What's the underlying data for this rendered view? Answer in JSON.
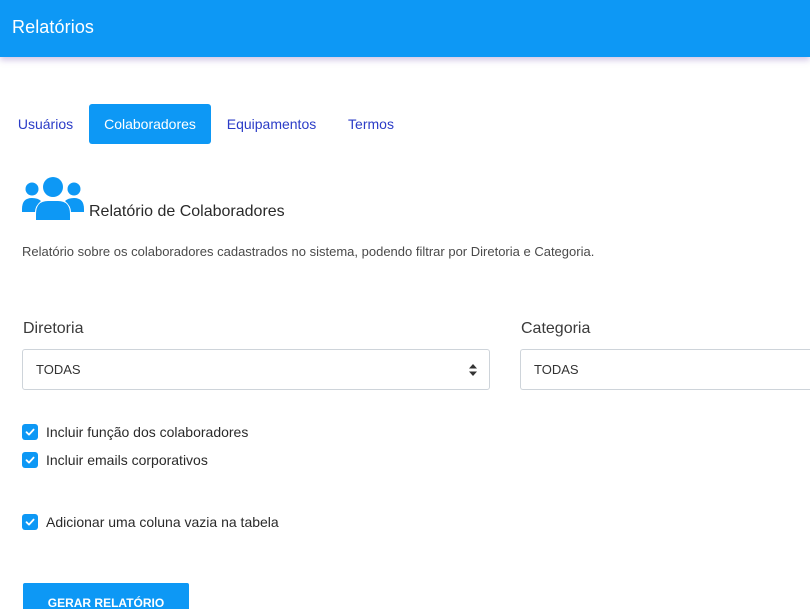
{
  "header": {
    "title": "Relatórios"
  },
  "tabs": [
    {
      "label": "Usuários",
      "active": false
    },
    {
      "label": "Colaboradores",
      "active": true
    },
    {
      "label": "Equipamentos",
      "active": false
    },
    {
      "label": "Termos",
      "active": false
    }
  ],
  "section": {
    "icon": "users-group-icon",
    "title": "Relatório de Colaboradores",
    "description": "Relatório sobre os colaboradores cadastrados no sistema, podendo filtrar por Diretoria e Categoria."
  },
  "filters": {
    "diretoria": {
      "label": "Diretoria",
      "value": "TODAS"
    },
    "categoria": {
      "label": "Categoria",
      "value": "TODAS"
    }
  },
  "options": [
    {
      "label": "Incluir função dos colaboradores",
      "checked": true
    },
    {
      "label": "Incluir emails corporativos",
      "checked": true
    },
    {
      "label": "Adicionar uma coluna vazia na tabela",
      "checked": true
    }
  ],
  "actions": {
    "generate_label": "GERAR RELATÓRIO"
  },
  "colors": {
    "primary": "#0d98f5",
    "tab_text": "#2b3cc7"
  }
}
